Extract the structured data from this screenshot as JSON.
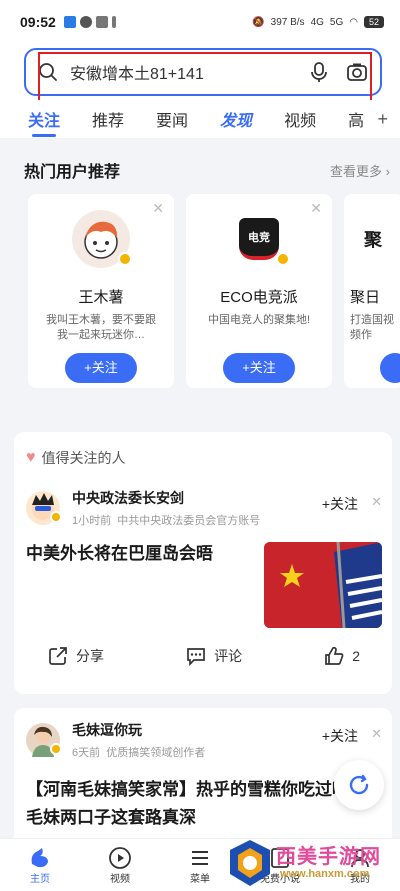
{
  "status_bar": {
    "time": "09:52",
    "speed": "397 B/s",
    "net1": "4G",
    "net2": "5G",
    "battery": "52"
  },
  "search": {
    "placeholder": "安徽增本土81+141"
  },
  "tabs": [
    {
      "label": "关注",
      "active": true
    },
    {
      "label": "推荐"
    },
    {
      "label": "要闻"
    },
    {
      "label": "发现"
    },
    {
      "label": "视频"
    },
    {
      "label": "高"
    }
  ],
  "hot_users": {
    "title": "热门用户推荐",
    "see_more": "查看更多",
    "cards": [
      {
        "name": "王木薯",
        "desc": "我叫王木薯，要不要跟我一起来玩迷你…",
        "follow": "+关注"
      },
      {
        "name": "ECO电竞派",
        "desc": "中国电竞人的聚集地!",
        "follow": "+关注",
        "logo_text": "电竞"
      },
      {
        "name": "聚日",
        "desc": "打造国视频作",
        "logo_text": "聚"
      }
    ]
  },
  "feed": {
    "section_title": "值得关注的人",
    "post1": {
      "author": "中央政法委长安剑",
      "time": "1小时前",
      "source": "中共中央政法委员会官方账号",
      "follow": "+关注",
      "title": "中美外长将在巴厘岛会晤",
      "share": "分享",
      "comment": "评论",
      "likes": "2"
    },
    "post2": {
      "author": "毛妹逗你玩",
      "time": "6天前",
      "source": "优质搞笑领域创作者",
      "follow": "+关注",
      "title": "【河南毛妹搞笑家常】热乎的雪糕你吃过吗？毛妹两口子这套路真深"
    }
  },
  "bottom_nav": [
    {
      "label": "主页",
      "active": true
    },
    {
      "label": "视频"
    },
    {
      "label": "菜单"
    },
    {
      "label": "免费小说"
    },
    {
      "label": "我的"
    }
  ],
  "watermark": {
    "text": "西美手游网",
    "url": "www.hanxm.com"
  },
  "colors": {
    "accent": "#3b6cf6",
    "highlight_box": "#e02020"
  }
}
